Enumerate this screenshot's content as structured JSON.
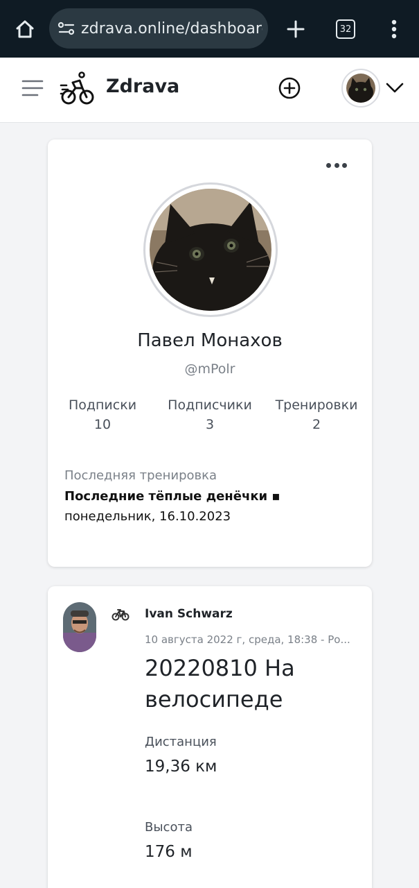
{
  "browser": {
    "url": "zdrava.online/dashboard",
    "tab_count": "32",
    "icons": [
      "home-icon",
      "tune-icon",
      "plus-icon",
      "tabs-icon",
      "more-vert-icon"
    ]
  },
  "header": {
    "brand": "Zdrava",
    "icons": [
      "hamburger-icon",
      "cyclist-logo-icon",
      "add-circle-icon",
      "chevron-down-icon"
    ]
  },
  "profile": {
    "name": "Павел Монахов",
    "handle": "@mPolr",
    "stats": [
      {
        "label": "Подписки",
        "value": "10"
      },
      {
        "label": "Подписчики",
        "value": "3"
      },
      {
        "label": "Тренировки",
        "value": "2"
      }
    ],
    "last_workout_label": "Последняя тренировка",
    "last_workout_title": "Последние тёплые денёчки ▪",
    "last_workout_date": "понедельник, 16.10.2023"
  },
  "activity": {
    "user": "Ivan Schwarz",
    "meta": "10 августа 2022 г, среда, 18:38 - Ро...",
    "title": "20220810 На велосипеде",
    "metrics": [
      {
        "label": "Дистанция",
        "value": "19,36 км"
      },
      {
        "label": "Высота",
        "value": "176 м"
      }
    ]
  },
  "colors": {
    "browser_bar": "#0f1b24",
    "url_pill": "#2b3942",
    "page_bg": "#f3f4f6",
    "card_bg": "#ffffff",
    "text_primary": "#1f2328",
    "text_muted": "#7a8088"
  }
}
